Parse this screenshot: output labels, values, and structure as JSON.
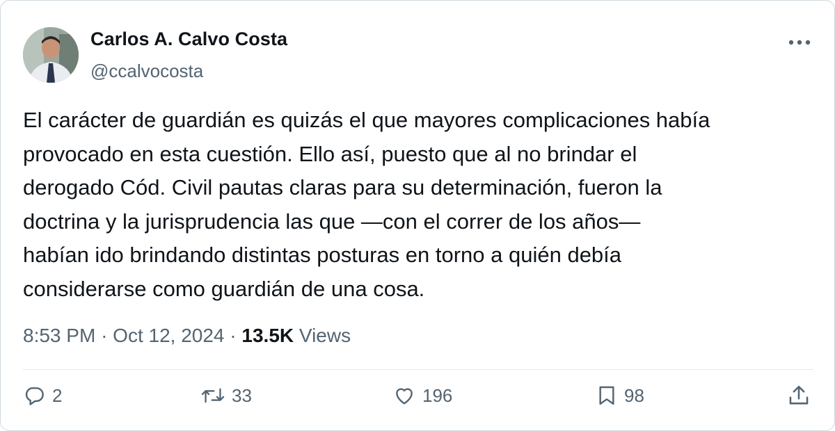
{
  "author": {
    "name": "Carlos A. Calvo Costa",
    "handle": "@ccalvocosta"
  },
  "tweet": {
    "text": "El carácter de guardián es quizás el que mayores complicaciones había\nprovocado en esta cuestión. Ello así, puesto que al no brindar el\nderogado Cód. Civil pautas claras para su determinación, fueron la\ndoctrina y la jurisprudencia las que —con el correr de los años—\nhabían ido brindando distintas posturas en torno a quién debía\nconsiderarse como guardián de una cosa."
  },
  "meta": {
    "time": "8:53 PM",
    "separator": "·",
    "date": "Oct 12, 2024",
    "views_count": "13.5K",
    "views_label": "Views"
  },
  "actions": {
    "replies": "2",
    "retweets": "33",
    "likes": "196",
    "bookmarks": "98"
  },
  "icons": {
    "more": "more-horizontal-icon",
    "reply": "reply-bubble-icon",
    "retweet": "retweet-icon",
    "like": "heart-icon",
    "bookmark": "bookmark-icon",
    "share": "share-upload-icon"
  },
  "colors": {
    "text": "#0f1419",
    "secondary": "#536471",
    "border": "#cfd9de"
  }
}
